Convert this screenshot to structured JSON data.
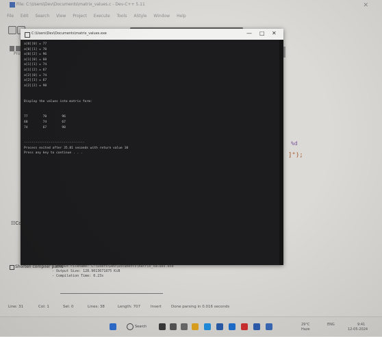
{
  "editor": {
    "window_title": "File: C:\\Users\\Dev\\Documents\\matrix_values.c - Dev-C++ 5.11",
    "menu": [
      "File",
      "Edit",
      "Search",
      "View",
      "Project",
      "Execute",
      "Tools",
      "AStyle",
      "Window",
      "Help"
    ],
    "sidebar_tab": "Project",
    "code_fragment_1": "%d",
    "code_fragment_2": "]\");",
    "left_marker": "Com",
    "left_marker_2": ""
  },
  "console": {
    "title": "C:\\Users\\Dev\\Documents\\matrix_values.exe",
    "controls": {
      "minimize": "—",
      "maximize": "□",
      "close": "✕"
    },
    "lines": [
      "a[0][0] = 77",
      "a[0][1] = 70",
      "a[0][2] = 96",
      "a[1][0] = 60",
      "a[1][1] = 74",
      "a[1][2] = 67",
      "a[2][0] = 74",
      "a[2][1] = 67",
      "a[2][2] = 98",
      "",
      "",
      "Display the values into matrix form:",
      "",
      "",
      "77        70        96",
      "60        74        67",
      "74        67        98",
      "",
      "",
      "--------------------------------",
      "Process exited after 35.81 seconds with return value 10",
      "Press any key to continue . . ."
    ]
  },
  "output": {
    "label": "Shorten compiler paths",
    "lines": [
      "- Output Filename: C:\\Users\\Dev\\Documents\\matrix_values.exe",
      "- Output Size: 128.9013671875 KiB",
      "- Compilation Time: 0.23s"
    ]
  },
  "status": {
    "line": "Line: 31",
    "col": "Col: 1",
    "sel": "Sel: 0",
    "lines": "Lines: 38",
    "length": "Length: 707",
    "insert": "Insert",
    "done": "Done parsing in 0.016 seconds"
  },
  "taskbar": {
    "search_label": "Search",
    "weather": "29°C",
    "weather_sub": "Haze",
    "lang": "ENG",
    "time": "9:41",
    "date": "12-05-2024"
  },
  "colors": {
    "console_bg": "#1c1c1e",
    "console_text": "#c8c8c8",
    "titlebar": "#f1f1ef",
    "page_bg": "#dcdad6"
  }
}
